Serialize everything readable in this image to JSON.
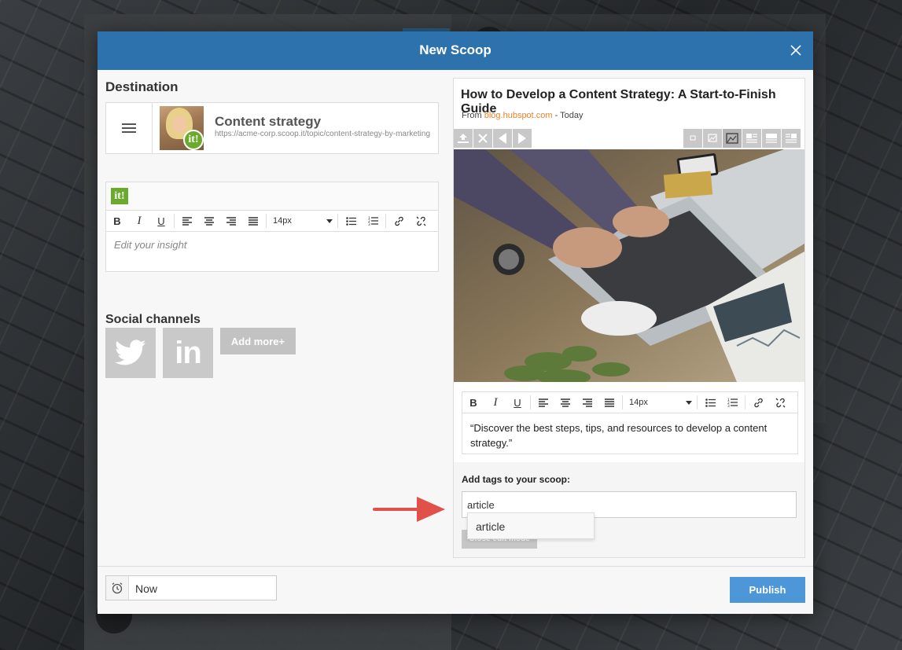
{
  "modal": {
    "title": "New Scoop"
  },
  "destination": {
    "heading": "Destination",
    "topic_name": "Content strategy",
    "topic_url": "https://acme-corp.scoop.it/topic/content-strategy-by-marketing",
    "badge": "it!"
  },
  "insight_editor": {
    "badge": "it!",
    "toolbar": {
      "bold": "B",
      "italic": "I",
      "underline": "U",
      "font_size": "14px"
    },
    "placeholder": "Edit your insight"
  },
  "social": {
    "heading": "Social channels",
    "channels": [
      {
        "name": "twitter",
        "icon": "twitter-icon"
      },
      {
        "name": "linkedin",
        "icon": "linkedin-icon",
        "glyph": "in"
      }
    ],
    "add_more_label": "Add more+"
  },
  "article": {
    "title": "How to Develop a Content Strategy: A Start-to-Finish Guide",
    "from_prefix": "From",
    "source": "blog.hubspot.com",
    "date": "- Today",
    "quote": "“Discover the best steps, tips, and resources to develop a content strategy.”",
    "toolbar": {
      "bold": "B",
      "italic": "I",
      "underline": "U",
      "font_size": "14px"
    }
  },
  "tags": {
    "label": "Add tags to your scoop:",
    "value": "article",
    "suggestions": [
      "article"
    ],
    "close_edit_label": "Close edit mode"
  },
  "footer": {
    "schedule_value": "Now",
    "publish_label": "Publish"
  },
  "colors": {
    "header": "#2e72ad",
    "publish": "#4d97d8",
    "scoopit_green": "#6aaa2c",
    "source_link": "#e8832a",
    "annotation_arrow": "#e05149"
  }
}
